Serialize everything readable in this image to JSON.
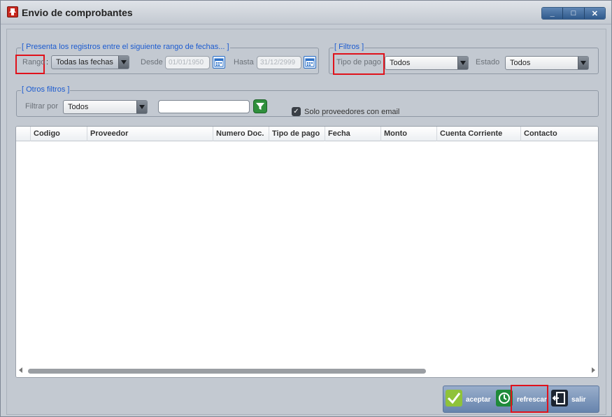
{
  "window": {
    "title": "Envio de comprobantes",
    "controls": [
      "_",
      "□",
      "✕"
    ]
  },
  "range_group": {
    "legend": "[ Presenta los registros entre el siguiente rango de fechas... ]",
    "range_label": "Rango",
    "range_colon": ":",
    "range_value": "Todas las fechas",
    "from_label": "Desde",
    "from_value": "01/01/1950",
    "to_label": "Hasta",
    "to_value": "31/12/2999"
  },
  "filters_group": {
    "legend": "[ Filtros ]",
    "payment_type_label": "Tipo de pago",
    "payment_type_value": "Todos",
    "status_label": "Estado",
    "status_value": "Todos"
  },
  "other_filters_group": {
    "legend": "[ Otros filtros ]",
    "filter_by_label": "Filtrar por",
    "filter_by_value": "Todos",
    "search_value": "",
    "email_only_label": "Solo proveedores con email",
    "email_only_checked": true
  },
  "grid": {
    "columns": [
      "Codigo",
      "Proveedor",
      "Numero Doc.",
      "Tipo de pago",
      "Fecha",
      "Monto",
      "Cuenta Corriente",
      "Contacto"
    ],
    "rows": []
  },
  "actions": {
    "accept": "aceptar",
    "refresh": "refrescar",
    "exit": "salir"
  },
  "colors": {
    "legend": "#1c5bd0",
    "highlight": "#e0121b",
    "accept_icon": "#8fc23a",
    "refresh_icon": "#1f8a3a"
  }
}
